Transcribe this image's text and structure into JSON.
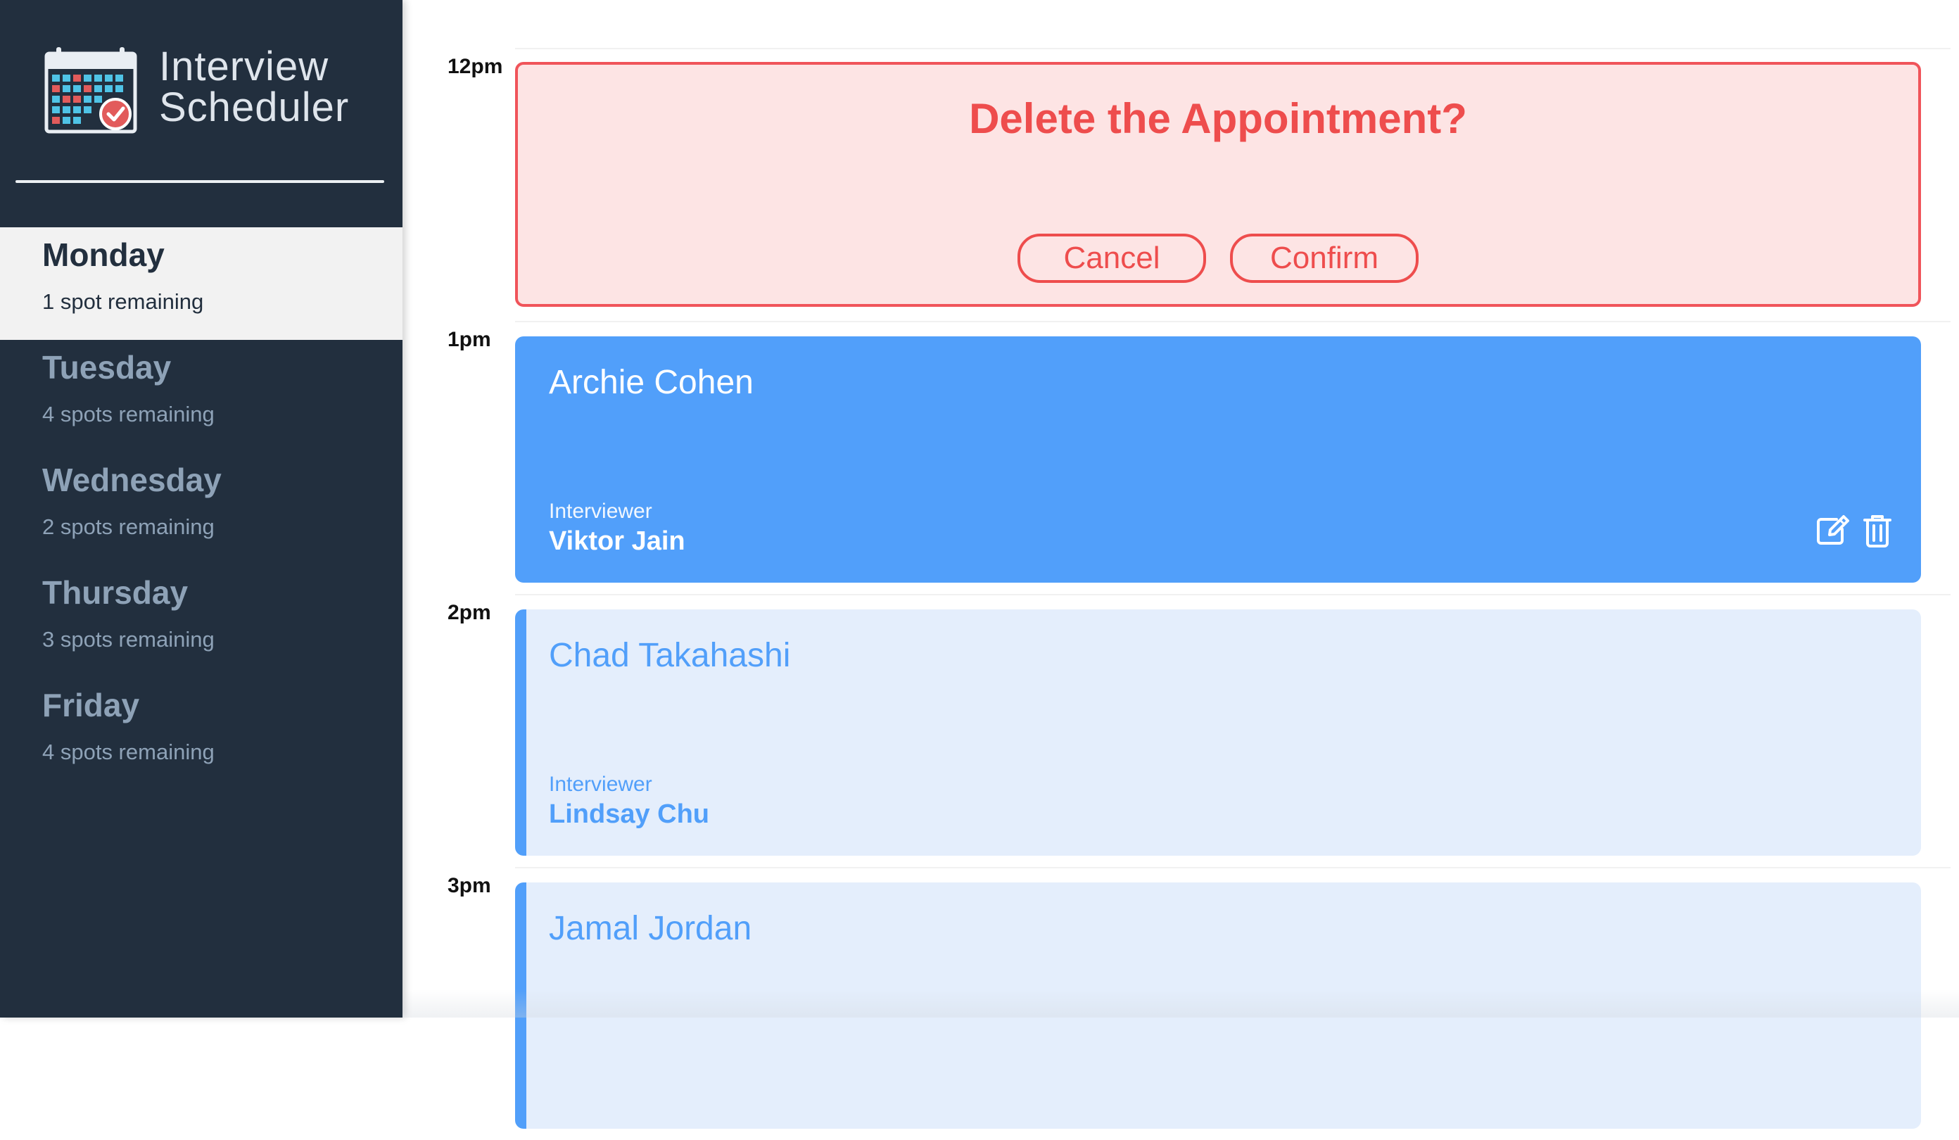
{
  "app": {
    "title_line1": "Interview",
    "title_line2": "Scheduler"
  },
  "sidebar": {
    "days": [
      {
        "name": "Monday",
        "spots": "1 spot remaining",
        "selected": true
      },
      {
        "name": "Tuesday",
        "spots": "4 spots remaining",
        "selected": false
      },
      {
        "name": "Wednesday",
        "spots": "2 spots remaining",
        "selected": false
      },
      {
        "name": "Thursday",
        "spots": "3 spots remaining",
        "selected": false
      },
      {
        "name": "Friday",
        "spots": "4 spots remaining",
        "selected": false
      }
    ]
  },
  "schedule": {
    "slots": [
      {
        "time": "12pm",
        "state": "confirm",
        "confirm_message": "Delete the Appointment?",
        "cancel_label": "Cancel",
        "confirm_label": "Confirm"
      },
      {
        "time": "1pm",
        "state": "show",
        "student": "Archie Cohen",
        "interviewer_label": "Interviewer",
        "interviewer": "Viktor Jain",
        "actions": [
          "edit-icon",
          "trash-icon"
        ]
      },
      {
        "time": "2pm",
        "state": "show",
        "student": "Chad Takahashi",
        "interviewer_label": "Interviewer",
        "interviewer": "Lindsay Chu"
      },
      {
        "time": "3pm",
        "state": "show",
        "student": "Jamal Jordan"
      }
    ]
  },
  "colors": {
    "sidebar_bg": "#222f3e",
    "accent_blue": "#519ffa",
    "danger_red": "#ee4d4d",
    "confirm_bg": "#fde4e4",
    "pending_bg": "#e4eefc"
  }
}
